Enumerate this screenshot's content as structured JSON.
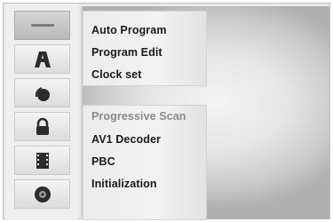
{
  "sidebar": {
    "items": [
      {
        "name": "general-icon",
        "selected": true
      },
      {
        "name": "language-icon",
        "selected": false
      },
      {
        "name": "audio-icon",
        "selected": false
      },
      {
        "name": "lock-icon",
        "selected": false
      },
      {
        "name": "recording-icon",
        "selected": false
      },
      {
        "name": "disc-icon",
        "selected": false
      }
    ]
  },
  "menu": {
    "items": [
      {
        "label": "Auto Program",
        "enabled": true
      },
      {
        "label": "Program Edit",
        "enabled": true
      },
      {
        "label": "Clock set",
        "enabled": true
      },
      {
        "label": "Progressive Scan",
        "enabled": false
      },
      {
        "label": "AV1 Decoder",
        "enabled": true
      },
      {
        "label": "PBC",
        "enabled": true
      },
      {
        "label": "Initialization",
        "enabled": true
      }
    ]
  },
  "colors": {
    "icon_fill": "#2b2b2b",
    "text": "#1a1a1a",
    "disabled_text": "#8a8a8a"
  }
}
